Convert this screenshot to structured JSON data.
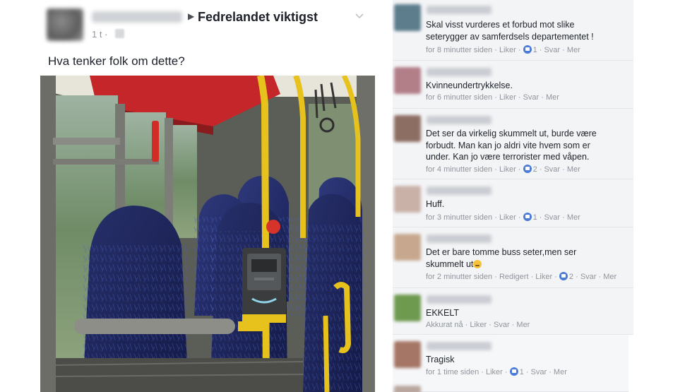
{
  "post": {
    "group": "Fedrelandet viktigst",
    "time": "1 t ·",
    "text": "Hva tenker folk om dette?"
  },
  "comments": [
    {
      "lines": [
        "Skal visst vurderes et forbud mot slike",
        "seterygger av samferdsels departementet !"
      ],
      "time": "for 8 minutter siden",
      "actions": [
        "Liker",
        "Svar",
        "Mer"
      ],
      "reactions": "1",
      "avatar_color": "#5d7d8c"
    },
    {
      "lines": [
        "Kvinneundertrykkelse."
      ],
      "time": "for 6 minutter siden",
      "actions": [
        "Liker",
        "Svar",
        "Mer"
      ],
      "avatar_color": "#b27e88"
    },
    {
      "lines": [
        "Det ser da virkelig skummelt ut, burde være",
        "forbudt. Man kan jo aldri vite hvem som er",
        "under. Kan jo være terrorister med våpen."
      ],
      "time": "for 4 minutter siden",
      "actions": [
        "Liker",
        "Svar",
        "Mer"
      ],
      "reactions": "2",
      "avatar_color": "#8d6e62"
    },
    {
      "lines": [
        "Huff."
      ],
      "time": "for 3 minutter siden",
      "actions": [
        "Liker",
        "Svar",
        "Mer"
      ],
      "reactions": "1",
      "avatar_color": "#c9b1a8"
    },
    {
      "lines": [
        "Det er bare tomme buss seter,men ser",
        "skummelt ut"
      ],
      "time": "for 2 minutter siden",
      "edited": "Redigert",
      "actions": [
        "Liker",
        "Svar",
        "Mer"
      ],
      "reactions": "2",
      "avatar_color": "#c7a88f"
    },
    {
      "lines": [
        "EKKELT"
      ],
      "time": "Akkurat nå",
      "actions": [
        "Liker",
        "Svar",
        "Mer"
      ],
      "avatar_color": "#6d9a4f"
    },
    {
      "lines": [
        "Tragisk"
      ],
      "time": "for 1 time siden",
      "actions": [
        "Liker",
        "Svar",
        "Mer"
      ],
      "reactions": "1",
      "avatar_color": "#a57565"
    }
  ]
}
